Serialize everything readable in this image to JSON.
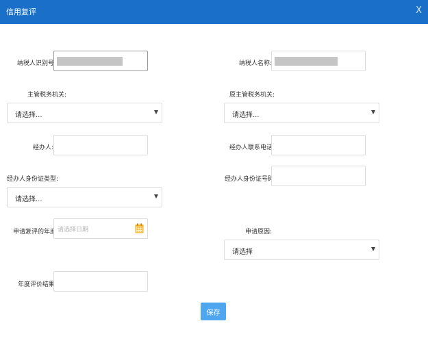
{
  "dialog": {
    "title": "信用复评",
    "close_label": "X"
  },
  "form": {
    "taxpayer_id": {
      "label": "纳税人识别号:"
    },
    "taxpayer_name": {
      "label": "纳税人名称:"
    },
    "tax_authority": {
      "label": "主管税务机关:",
      "value": "请选择..."
    },
    "orig_tax_authority": {
      "label": "原主管税务机关:",
      "value": "请选择..."
    },
    "handler": {
      "label": "经办人:",
      "value": ""
    },
    "handler_phone": {
      "label": "经办人联系电话:",
      "value": ""
    },
    "handler_id_type": {
      "label": "经办人身份证类型:",
      "value": "请选择..."
    },
    "handler_id_number": {
      "label": "经办人身份证号码:",
      "value": ""
    },
    "review_year": {
      "label": "申请复评的年度:",
      "placeholder": "请选择日期"
    },
    "reason": {
      "label": "申请原因:",
      "value": "请选择"
    },
    "annual_result": {
      "label": "年度评价结果:",
      "value": ""
    }
  },
  "actions": {
    "save_label": "保存"
  },
  "colors": {
    "header": "#1a70c9",
    "button": "#4ea6ef",
    "calendar": "#f3ae1b"
  }
}
